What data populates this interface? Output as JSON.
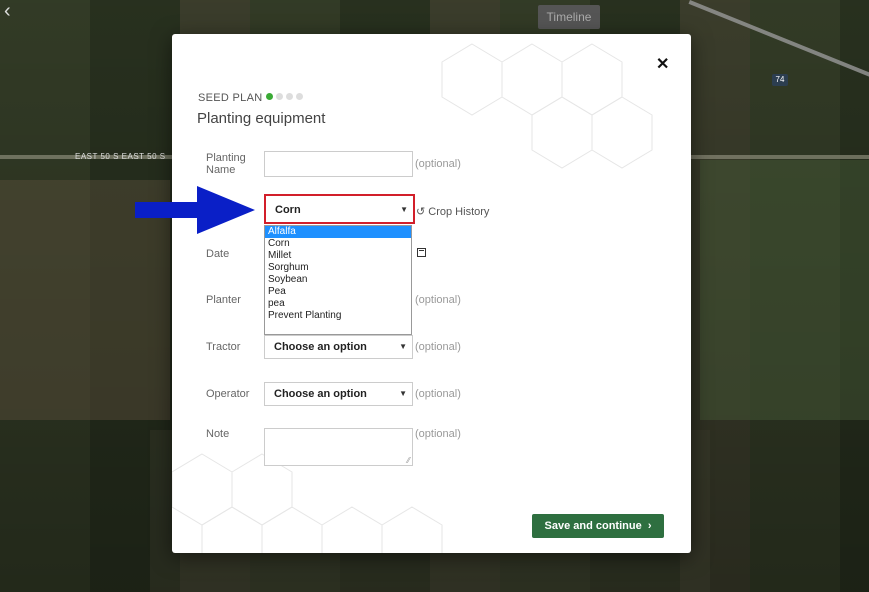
{
  "map": {
    "timeline_tab": "Timeline",
    "road_label": "EAST 50 S EAST 50 S",
    "route_shield": "74"
  },
  "modal": {
    "kicker": "SEED PLAN",
    "progress": {
      "current_step": 1,
      "total_steps": 4
    },
    "title": "Planting equipment",
    "close_icon": "close-icon",
    "fields": {
      "planting_name": {
        "label": "Planting Name",
        "value": "",
        "hint": "(optional)"
      },
      "crop": {
        "selected": "Corn",
        "options": [
          "Alfalfa",
          "Corn",
          "Millet",
          "Sorghum",
          "Soybean",
          "Pea",
          "pea",
          "Prevent Planting"
        ],
        "highlighted": "Alfalfa"
      },
      "crop_history_link": "Crop History",
      "date": {
        "label": "Date"
      },
      "planter": {
        "label": "Planter",
        "hint": "(optional)"
      },
      "tractor": {
        "label": "Tractor",
        "value": "Choose an option",
        "hint": "(optional)"
      },
      "operator": {
        "label": "Operator",
        "value": "Choose an option",
        "hint": "(optional)"
      },
      "note": {
        "label": "Note",
        "value": "",
        "hint": "(optional)"
      }
    },
    "save_button": "Save and continue",
    "colors": {
      "accent_green": "#3aaa35",
      "button_green": "#2e6f40",
      "highlight_red": "#d21f2a",
      "annotation_blue": "#0a1fc7",
      "selected_blue": "#1e90ff"
    }
  }
}
